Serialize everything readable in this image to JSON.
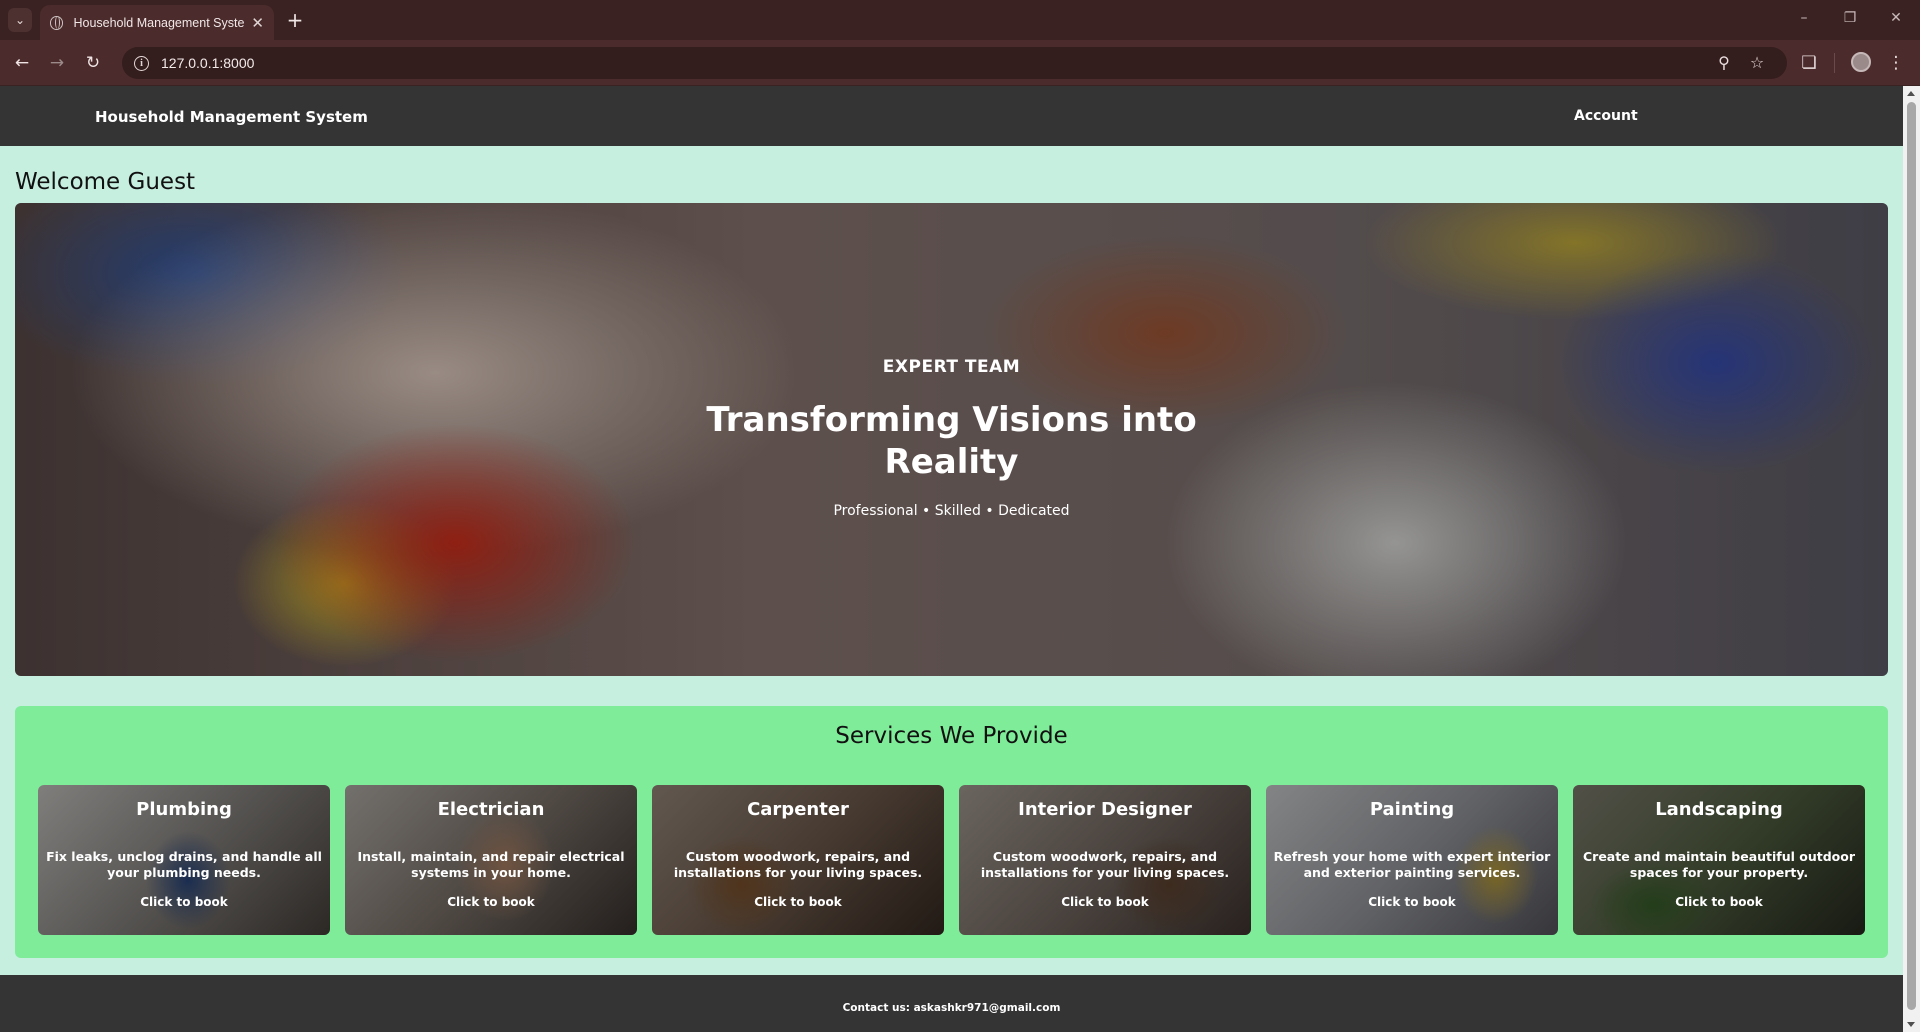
{
  "browser": {
    "tab_title": "Household Management System",
    "url": "127.0.0.1:8000",
    "icons": {
      "tab_menu": "chevron-down-icon",
      "favicon": "globe-icon",
      "close": "close-icon",
      "new_tab": "plus-icon",
      "back": "back-arrow-icon",
      "forward": "forward-arrow-icon",
      "reload": "reload-icon",
      "site_info": "info-icon",
      "zoom": "zoom-icon",
      "bookmark": "star-icon",
      "extensions": "puzzle-icon",
      "profile": "avatar",
      "menu": "kebab-menu-icon"
    },
    "colors": {
      "frame": "#3a2222",
      "toolbar": "#4b2b2b"
    }
  },
  "navbar": {
    "brand": "Household Management System",
    "account": "Account"
  },
  "welcome": "Welcome Guest",
  "hero": {
    "kicker": "EXPERT TEAM",
    "title": "Transforming Visions into Reality",
    "subtitle": "Professional • Skilled • Dedicated"
  },
  "services": {
    "title": "Services We Provide",
    "items": [
      {
        "title": "Plumbing",
        "desc": "Fix leaks, unclog drains, and handle all your plumbing needs.",
        "cta": "Click to book"
      },
      {
        "title": "Electrician",
        "desc": "Install, maintain, and repair electrical systems in your home.",
        "cta": "Click to book"
      },
      {
        "title": "Carpenter",
        "desc": "Custom woodwork, repairs, and installations for your living spaces.",
        "cta": "Click to book"
      },
      {
        "title": "Interior Designer",
        "desc": "Custom woodwork, repairs, and installations for your living spaces.",
        "cta": "Click to book"
      },
      {
        "title": "Painting",
        "desc": "Refresh your home with expert interior and exterior painting services.",
        "cta": "Click to book"
      },
      {
        "title": "Landscaping",
        "desc": "Create and maintain beautiful outdoor spaces for your property.",
        "cta": "Click to book"
      }
    ]
  },
  "footer": {
    "contact": "Contact us: askashkr971@gmail.com"
  },
  "colors": {
    "page_bg": "#c6efe0",
    "nav_bg": "#343434",
    "services_bg": "#7fec99"
  }
}
